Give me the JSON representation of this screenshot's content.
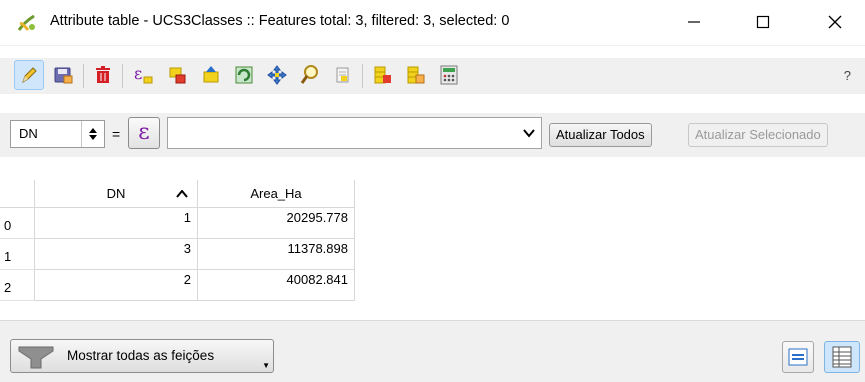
{
  "window": {
    "title": "Attribute table - UCS3Classes :: Features total: 3, filtered: 3, selected: 0"
  },
  "toolbar": {
    "buttons": [
      "toggle-editing-icon",
      "save-edits-icon",
      "delete-features-icon",
      "select-by-expression-icon",
      "deselect-all-icon",
      "move-selection-to-top-icon",
      "invert-selection-icon",
      "pan-to-selected-icon",
      "zoom-to-selected-icon",
      "copy-rows-icon",
      "delete-field-icon",
      "new-field-icon",
      "field-calculator-icon"
    ],
    "help": "?"
  },
  "filter": {
    "field": "DN",
    "equals": "=",
    "expression_glyph": "ε",
    "value": "",
    "update_all": "Atualizar Todos",
    "update_selected": "Atualizar Selecionado"
  },
  "table": {
    "columns": [
      "DN",
      "Area_Ha"
    ],
    "rows": [
      {
        "index": "0",
        "DN": "1",
        "Area_Ha": "20295.778"
      },
      {
        "index": "1",
        "DN": "3",
        "Area_Ha": "11378.898"
      },
      {
        "index": "2",
        "DN": "2",
        "Area_Ha": "40082.841"
      }
    ]
  },
  "bottom": {
    "show_all": "Mostrar todas as feições"
  },
  "colors": {
    "active_toolbar_bg": "#cfe6fb",
    "expression_purple": "#7e1ca8"
  }
}
